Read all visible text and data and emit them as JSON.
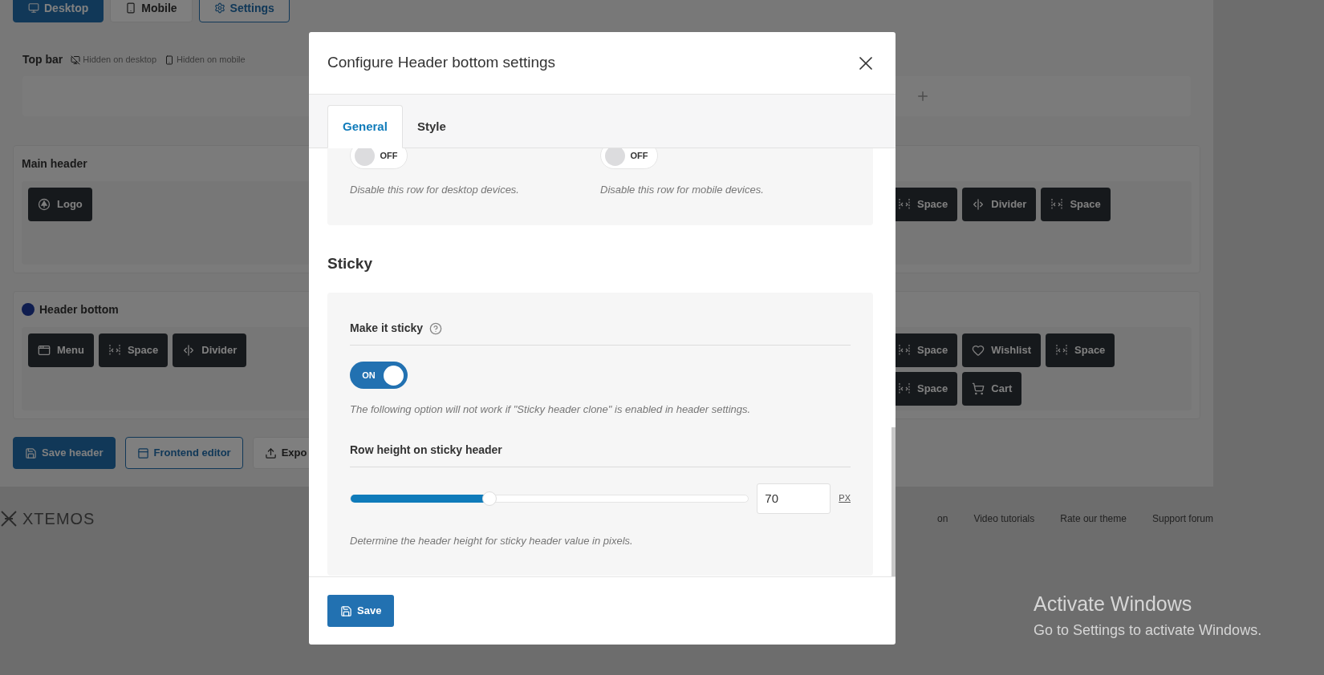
{
  "background": {
    "view_tabs": [
      {
        "label": "Desktop",
        "selected": true
      },
      {
        "label": "Mobile",
        "selected": false
      },
      {
        "label": "Settings",
        "selected": false
      }
    ],
    "top_bar": {
      "title": "Top bar",
      "badges": [
        "Hidden on desktop",
        "Hidden on mobile"
      ]
    },
    "rows": [
      {
        "title": "Main header",
        "marked": false,
        "left": [
          {
            "label": "Logo",
            "kind": "logo"
          }
        ],
        "right": [
          {
            "label": "Space",
            "kind": "space"
          },
          {
            "label": "Divider",
            "kind": "divider"
          },
          {
            "label": "Space",
            "kind": "space"
          }
        ]
      },
      {
        "title": "Header bottom",
        "marked": true,
        "left": [
          {
            "label": "Menu",
            "kind": "menu"
          },
          {
            "label": "Space",
            "kind": "space"
          },
          {
            "label": "Divider",
            "kind": "divider"
          }
        ],
        "right": [
          {
            "label": "Space",
            "kind": "space"
          },
          {
            "label": "Wishlist",
            "kind": "wishlist"
          },
          {
            "label": "Space",
            "kind": "space"
          },
          {
            "label": "Space",
            "kind": "space"
          },
          {
            "label": "Cart",
            "kind": "cart"
          }
        ]
      }
    ],
    "actions": [
      {
        "label": "Save header",
        "kind": "primary"
      },
      {
        "label": "Frontend editor",
        "kind": "outline"
      },
      {
        "label": "Expo",
        "kind": "plain"
      }
    ],
    "footer": {
      "logo": "XTEMOS",
      "links": [
        "on",
        "Video tutorials",
        "Rate our theme",
        "Support forum"
      ]
    }
  },
  "modal": {
    "title": "Configure Header bottom settings",
    "tabs": [
      {
        "label": "General",
        "selected": true
      },
      {
        "label": "Style",
        "selected": false
      }
    ],
    "visibility": [
      {
        "toggle": "OFF",
        "on": false,
        "description": "Disable this row for desktop devices."
      },
      {
        "toggle": "OFF",
        "on": false,
        "description": "Disable this row for mobile devices."
      }
    ],
    "section_title": "Sticky",
    "sticky": {
      "label": "Make it sticky",
      "toggle": "ON",
      "on": true,
      "note": "The following option will not work if \"Sticky header clone\" is enabled in header settings."
    },
    "row_height": {
      "label": "Row height on sticky header",
      "level": 0.35,
      "value": "70",
      "unit": "PX",
      "description": "Determine the header height for sticky header value in pixels."
    },
    "save": "Save"
  },
  "os_notice": {
    "title": "Activate Windows",
    "subtitle": "Go to Settings to activate Windows."
  }
}
